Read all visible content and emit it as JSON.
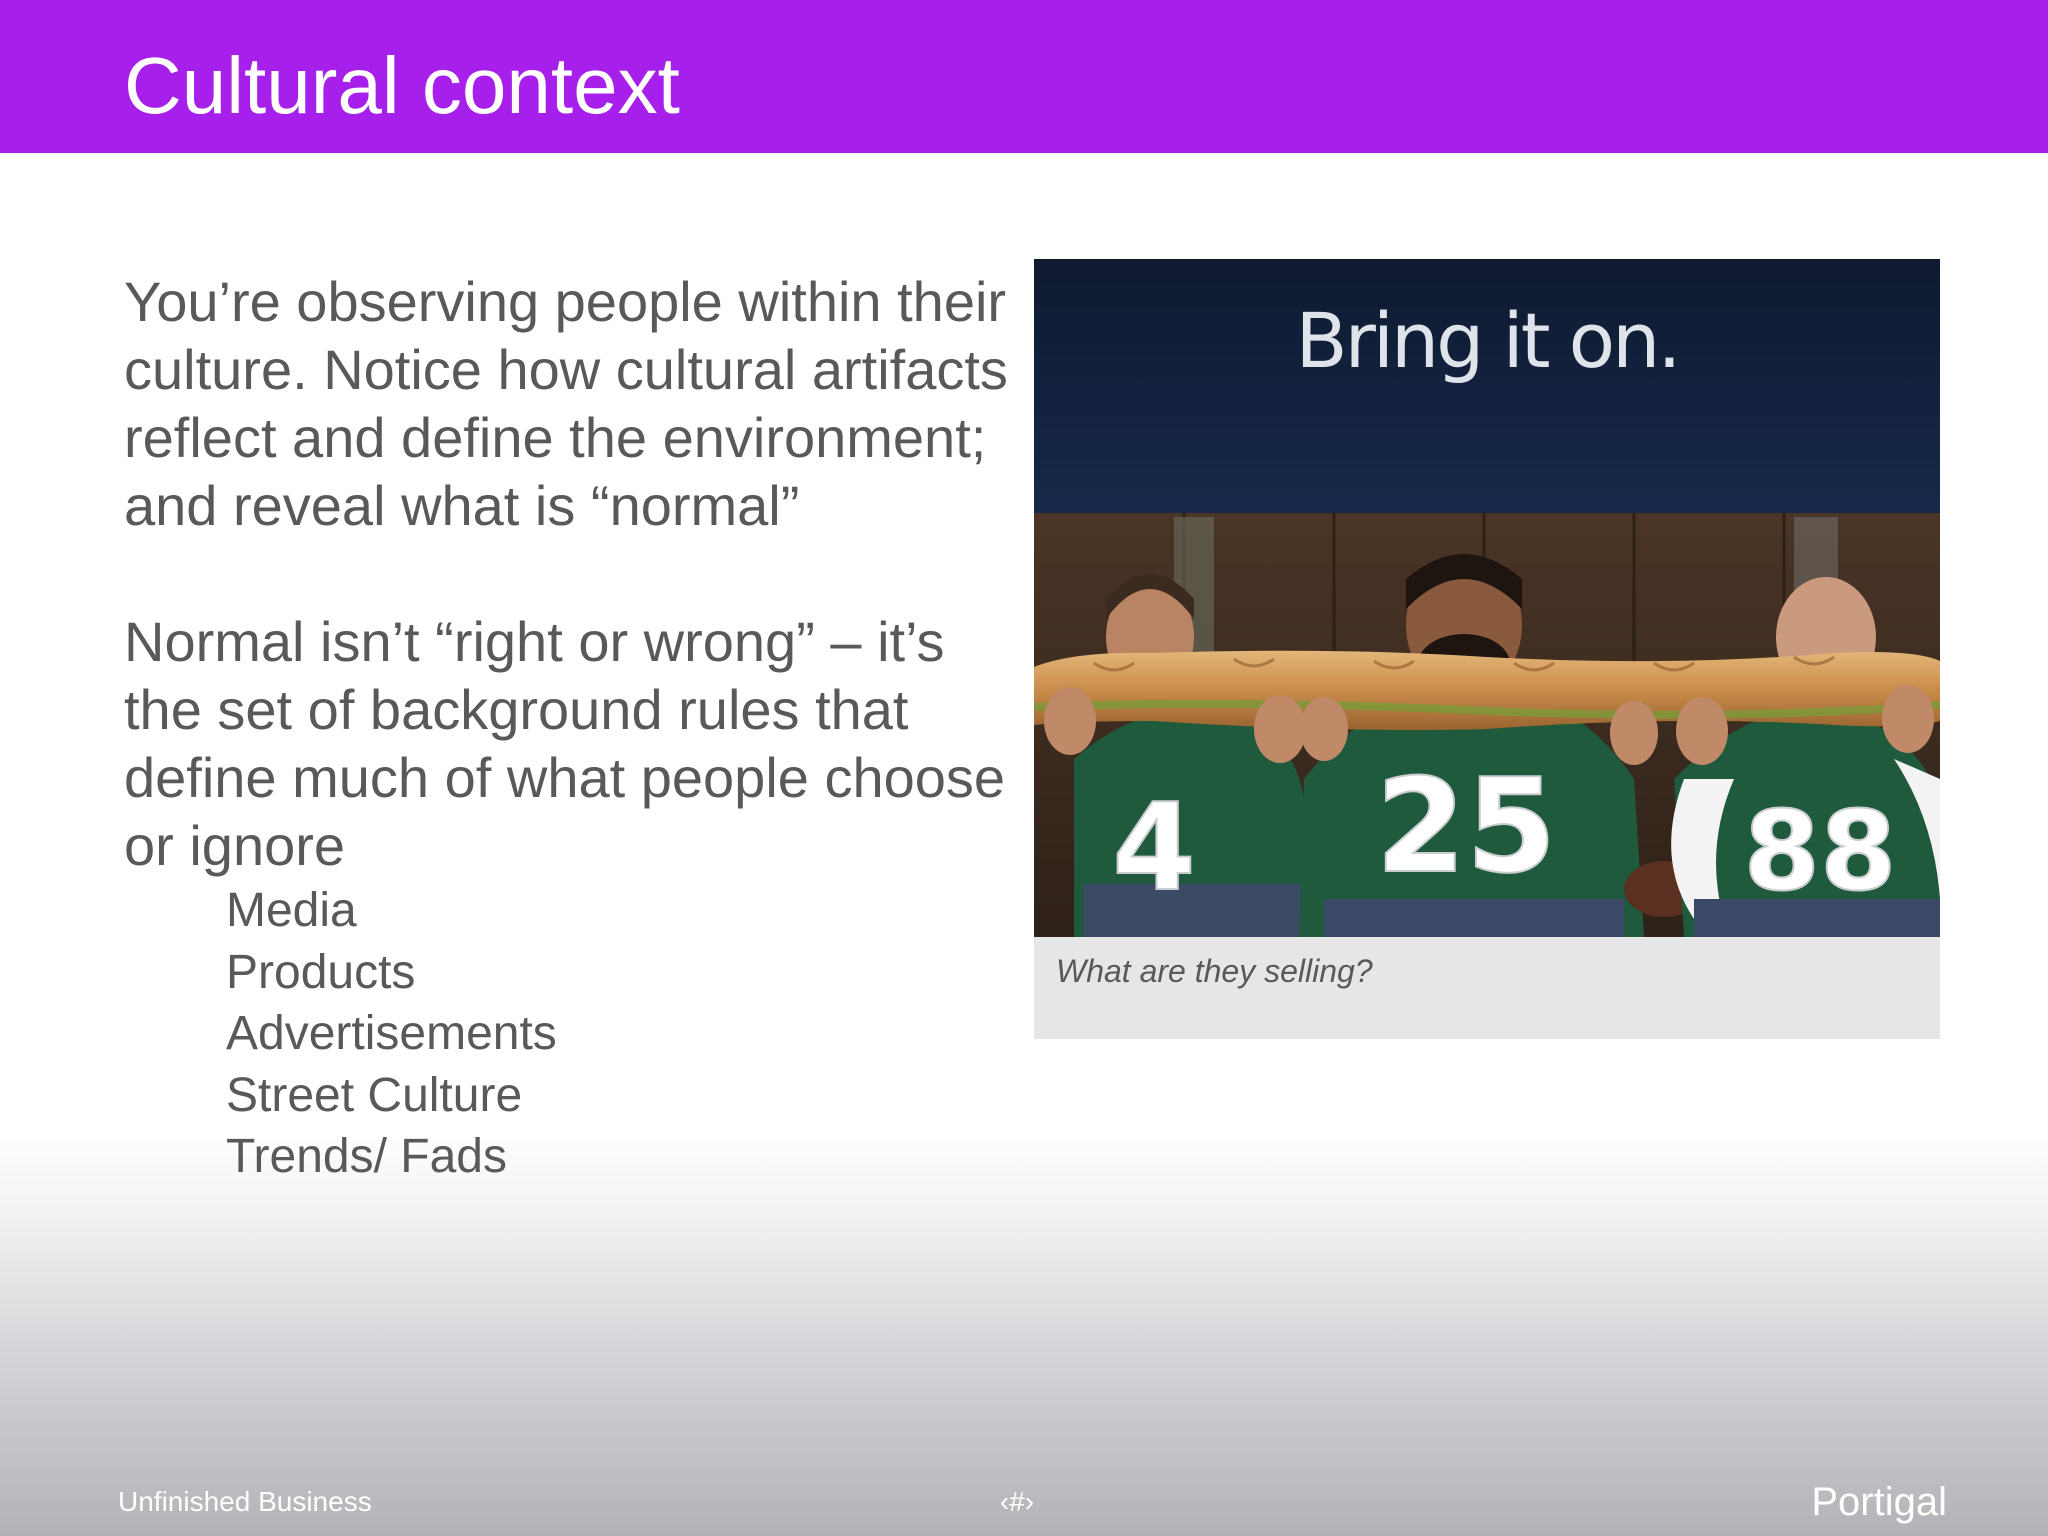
{
  "slide": {
    "title": "Cultural context",
    "paragraphs": [
      "You’re observing people within their culture. Notice how cultural artifacts reflect and define the environment; and reveal what is “normal”",
      "Normal isn’t “right or wrong” – it’s the set of background rules that define much of what people choose or ignore"
    ],
    "sub_items": [
      "Media",
      "Products",
      "Advertisements",
      "Street Culture",
      "Trends/ Fads"
    ]
  },
  "photo": {
    "headline": "Bring it on.",
    "jersey_numbers": [
      "4",
      "25",
      "88"
    ],
    "caption": "What are they selling?"
  },
  "footer": {
    "left": "Unfinished Business",
    "center": "‹#›",
    "right": "Portigal"
  },
  "colors": {
    "title_bar": "#a61fea",
    "body_text": "#595959",
    "jersey_green": "#1f5a3c",
    "ad_navy": "#12203a"
  }
}
